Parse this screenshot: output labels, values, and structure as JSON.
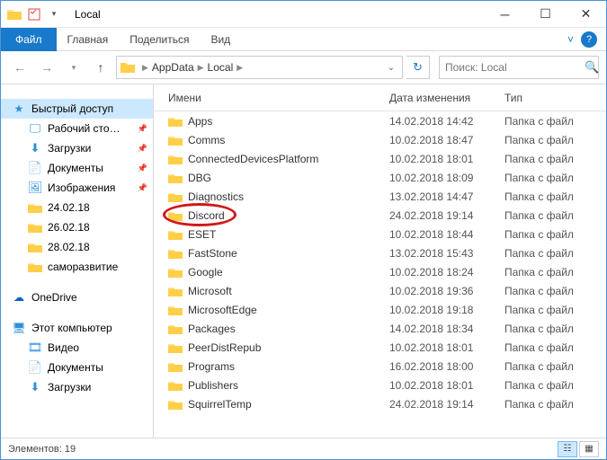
{
  "window": {
    "title": "Local"
  },
  "ribbon": {
    "file": "Файл",
    "tabs": [
      "Главная",
      "Поделиться",
      "Вид"
    ]
  },
  "address": {
    "crumbs": [
      "AppData",
      "Local"
    ],
    "search_placeholder": "Поиск: Local"
  },
  "sidebar": {
    "quick": {
      "label": "Быстрый доступ"
    },
    "quick_items": [
      {
        "label": "Рабочий сто…",
        "icon": "desktop",
        "pinned": true
      },
      {
        "label": "Загрузки",
        "icon": "downloads",
        "pinned": true
      },
      {
        "label": "Документы",
        "icon": "documents",
        "pinned": true
      },
      {
        "label": "Изображения",
        "icon": "pictures",
        "pinned": true
      },
      {
        "label": "24.02.18",
        "icon": "folder",
        "pinned": false
      },
      {
        "label": "26.02.18",
        "icon": "folder",
        "pinned": false
      },
      {
        "label": "28.02.18",
        "icon": "folder",
        "pinned": false
      },
      {
        "label": "саморазвитие",
        "icon": "folder",
        "pinned": false
      }
    ],
    "onedrive": {
      "label": "OneDrive"
    },
    "thispc": {
      "label": "Этот компьютер"
    },
    "pc_items": [
      {
        "label": "Видео",
        "icon": "videos"
      },
      {
        "label": "Документы",
        "icon": "documents"
      },
      {
        "label": "Загрузки",
        "icon": "downloads"
      }
    ]
  },
  "columns": {
    "name": "Имени",
    "date": "Дата изменения",
    "type": "Тип"
  },
  "files": [
    {
      "name": "Apps",
      "date": "14.02.2018 14:42",
      "type": "Папка с файл",
      "highlight": false
    },
    {
      "name": "Comms",
      "date": "10.02.2018 18:47",
      "type": "Папка с файл",
      "highlight": false
    },
    {
      "name": "ConnectedDevicesPlatform",
      "date": "10.02.2018 18:01",
      "type": "Папка с файл",
      "highlight": false
    },
    {
      "name": "DBG",
      "date": "10.02.2018 18:09",
      "type": "Папка с файл",
      "highlight": false
    },
    {
      "name": "Diagnostics",
      "date": "13.02.2018 14:47",
      "type": "Папка с файл",
      "highlight": false
    },
    {
      "name": "Discord",
      "date": "24.02.2018 19:14",
      "type": "Папка с файл",
      "highlight": true
    },
    {
      "name": "ESET",
      "date": "10.02.2018 18:44",
      "type": "Папка с файл",
      "highlight": false
    },
    {
      "name": "FastStone",
      "date": "13.02.2018 15:43",
      "type": "Папка с файл",
      "highlight": false
    },
    {
      "name": "Google",
      "date": "10.02.2018 18:24",
      "type": "Папка с файл",
      "highlight": false
    },
    {
      "name": "Microsoft",
      "date": "10.02.2018 19:36",
      "type": "Папка с файл",
      "highlight": false
    },
    {
      "name": "MicrosoftEdge",
      "date": "10.02.2018 19:18",
      "type": "Папка с файл",
      "highlight": false
    },
    {
      "name": "Packages",
      "date": "14.02.2018 18:34",
      "type": "Папка с файл",
      "highlight": false
    },
    {
      "name": "PeerDistRepub",
      "date": "10.02.2018 18:01",
      "type": "Папка с файл",
      "highlight": false
    },
    {
      "name": "Programs",
      "date": "16.02.2018 18:00",
      "type": "Папка с файл",
      "highlight": false
    },
    {
      "name": "Publishers",
      "date": "10.02.2018 18:01",
      "type": "Папка с файл",
      "highlight": false
    },
    {
      "name": "SquirrelTemp",
      "date": "24.02.2018 19:14",
      "type": "Папка с файл",
      "highlight": false
    }
  ],
  "status": {
    "count_label": "Элементов: 19"
  }
}
